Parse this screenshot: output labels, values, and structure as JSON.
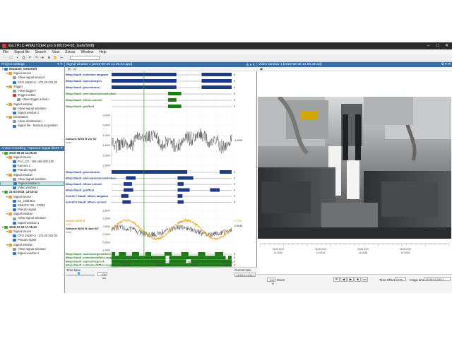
{
  "window": {
    "title": "iba.t  PLC-ANALYZER.pro 6 [00234-03_GebrShift]",
    "controls": [
      "–",
      "□",
      "✕"
    ]
  },
  "menu": [
    "File",
    "Signal file",
    "Search",
    "View",
    "Extras",
    "Window",
    "Help"
  ],
  "toolbar": {
    "icons": [
      "new-icon",
      "open-icon",
      "save-icon",
      "print-icon",
      "undo-icon",
      "redo-icon",
      "cursor-icon",
      "zoom-icon",
      "hand-icon",
      "measure-icon"
    ],
    "glyphs": [
      "▫",
      "▭",
      "▪",
      "⎙",
      "↶",
      "↷",
      "➤",
      "⊕",
      "✋",
      "⊢"
    ],
    "combo_value": ""
  },
  "project": {
    "header": "Project settings",
    "rows": [
      {
        "d": 0,
        "t": "00234-03_GebrShift",
        "b": true,
        "c": "#37c"
      },
      {
        "d": 1,
        "t": "Signal source",
        "c": "#e93"
      },
      {
        "d": 2,
        "t": "<New signal source>",
        "c": "#999"
      },
      {
        "d": 2,
        "t": "CPU 1516F-3 - 172.20.202.32",
        "c": "#37c"
      },
      {
        "d": 1,
        "t": "Trigger",
        "c": "#e93"
      },
      {
        "d": 2,
        "t": "<New trigger>",
        "c": "#999"
      },
      {
        "d": 2,
        "t": "Trigger action",
        "c": "#c33"
      },
      {
        "d": 3,
        "t": "<New trigger action>",
        "c": "#999"
      },
      {
        "d": 1,
        "t": "Signal window",
        "c": "#e93"
      },
      {
        "d": 2,
        "t": "<New signal window>",
        "c": "#999"
      },
      {
        "d": 2,
        "t": "Signal window 1",
        "c": "#37c"
      },
      {
        "d": 1,
        "t": "Destination",
        "c": "#e93"
      },
      {
        "d": 2,
        "t": "<New destination>",
        "c": "#999"
      },
      {
        "d": 2,
        "t": "Signal file - Manual acquisition",
        "c": "#37c"
      }
    ]
  },
  "recordings": {
    "header": "Active recording / Opened signal files",
    "rows": [
      {
        "d": 0,
        "t": "2019-08-26 14.05.33",
        "b": true,
        "c": "#3a3"
      },
      {
        "d": 1,
        "t": "Signal source",
        "c": "#e93"
      },
      {
        "d": 2,
        "t": "PLC_C3 - 192.168.200.125",
        "c": "#37c"
      },
      {
        "d": 2,
        "t": "Kamera 1",
        "c": "#37c"
      },
      {
        "d": 2,
        "t": "Pseudo signal",
        "c": "#37c"
      },
      {
        "d": 1,
        "t": "Signal window",
        "c": "#e93"
      },
      {
        "d": 2,
        "t": "<New signal window>",
        "c": "#999"
      },
      {
        "d": 2,
        "t": "Signal window 1",
        "c": "#37c",
        "sel": true
      },
      {
        "d": 2,
        "t": "Video window 1",
        "c": "#37c"
      },
      {
        "d": 0,
        "t": "21-03-2018_13-10-22",
        "b": true,
        "c": "#3a3"
      },
      {
        "d": 1,
        "t": "Signal source",
        "c": "#e93"
      },
      {
        "d": 2,
        "t": "C1_USB Box",
        "c": "#37c"
      },
      {
        "d": 2,
        "t": "SIMATIC S5 - COM1",
        "c": "#37c"
      },
      {
        "d": 2,
        "t": "Pseudo signal",
        "c": "#37c"
      },
      {
        "d": 1,
        "t": "Signal window",
        "c": "#e93"
      },
      {
        "d": 2,
        "t": "<New signal window>",
        "c": "#999"
      },
      {
        "d": 2,
        "t": "Signal window 1",
        "c": "#37c"
      },
      {
        "d": 0,
        "t": "2018-01-19 17.05.34",
        "b": true,
        "c": "#3a3"
      },
      {
        "d": 1,
        "t": "Signal source",
        "c": "#e93"
      },
      {
        "d": 2,
        "t": "CPU 1516F-3 - 172.20.202.32",
        "c": "#37c"
      },
      {
        "d": 2,
        "t": "Pseudo signal",
        "c": "#37c"
      },
      {
        "d": 1,
        "t": "Signal window",
        "c": "#e93"
      },
      {
        "d": 2,
        "t": "<New signal window>",
        "c": "#999"
      },
      {
        "d": 2,
        "t": "Signal window 1",
        "c": "#37c"
      }
    ]
  },
  "signal_window": {
    "title": "Signal window 1 [2019-08-26 14.05.33.apw]",
    "digital_top": [
      {
        "label": "Bfwp Staufl. schließen langsam",
        "color": "#1d3a8a",
        "value": "0",
        "segs": [
          [
            0.0,
            0.54
          ],
          [
            0.75,
            1.0
          ]
        ]
      },
      {
        "label": "Bfwp Staufl. nachschiegen",
        "color": "#1d3a8a",
        "value": "0",
        "segs": [
          [
            0.0,
            0.54
          ],
          [
            0.75,
            1.0
          ]
        ]
      },
      {
        "label": "Bfwp Staufl. geschlossen",
        "color": "#1d3a8a",
        "value": "0",
        "segs": [
          [
            0.0,
            0.54
          ],
          [
            0.75,
            1.0
          ]
        ]
      },
      {
        "label": "Bfwp Staufl. oben absenken/anheben",
        "color": "#1e7a16",
        "value": "0",
        "segs": [
          [
            0.47,
            0.58
          ]
        ]
      },
      {
        "label": "Bfwp Staufl. öffnen schnell",
        "color": "#1e7a16",
        "value": "0",
        "segs": [
          [
            0.47,
            0.54
          ]
        ]
      },
      {
        "label": "Bfwp Staufl. geöffnet",
        "color": "#1e7a16",
        "value": "0",
        "segs": [
          [
            0.47,
            0.58
          ]
        ]
      }
    ],
    "analog1": {
      "label": "Sollwert WGS B vor N7",
      "unit": "mm/s",
      "value": "-1,2005",
      "yticks": [
        "0,0000",
        "-0,5000",
        "-1,0000",
        "-1,5000",
        "-2,0000",
        "-2,5000"
      ]
    },
    "digital_mid": [
      {
        "label": "Bfwp Staufl. geschlossen",
        "color": "#1d3a8a",
        "value": "0",
        "segs": [
          [
            0.0,
            0.63
          ],
          [
            0.9,
            1.0
          ]
        ]
      },
      {
        "label": "Bfwp Staufl. oben absenken/anheben",
        "color": "#1d3a8a",
        "value": "0",
        "segs": [
          [
            0.12,
            0.2
          ],
          [
            0.55,
            0.68
          ]
        ]
      },
      {
        "label": "Bfwp Staufl. öffnen schnell",
        "color": "#1d3a8a",
        "value": "0",
        "segs": [
          [
            0.1,
            0.17
          ],
          [
            0.55,
            0.6
          ]
        ]
      },
      {
        "label": "Bfwp Staufl. geöffnet",
        "color": "#1d3a8a",
        "value": "0",
        "segs": [
          [
            0.1,
            0.18
          ],
          [
            0.55,
            0.65
          ],
          [
            0.82,
            0.9
          ]
        ]
      },
      {
        "label": "Schritt 7 Staufl. öffnen langsam",
        "color": "#1d3a8a",
        "value": "0",
        "segs": [
          [
            0.08,
            0.14
          ],
          [
            0.55,
            0.59
          ]
        ]
      },
      {
        "label": "Schritt 8 Staufl. öffnen schnell",
        "color": "#1d3a8a",
        "value": "0",
        "segs": [
          [
            0.09,
            0.16
          ],
          [
            0.55,
            0.6
          ]
        ]
      }
    ],
    "analog2": {
      "label1": "Istwert WGS B",
      "unit1": "mm/s",
      "label2": "Sollwert WGS B nach N7",
      "unit2": "mm/s",
      "value1": "0,7500",
      "value2": "-0,5645",
      "yticks": [
        "1,5000",
        "1,0000",
        "0,5000",
        "0,0000",
        "-0,5000",
        "-1,0000"
      ]
    },
    "digital_bot": [
      {
        "label": "Bfwp Staufl. nachschiegen/öffnen",
        "color": "#1e7a16",
        "value": "0",
        "segs": [
          [
            0.0,
            0.03
          ],
          [
            0.06,
            0.12
          ],
          [
            0.17,
            0.23
          ],
          [
            0.28,
            0.33
          ],
          [
            0.44,
            0.5
          ],
          [
            0.58,
            0.64
          ],
          [
            0.72,
            0.78
          ],
          [
            0.86,
            0.93
          ]
        ]
      },
      {
        "label": "Bfwp Staufl. schließen/öffnen langsam",
        "color": "#1e7a16",
        "value": "0",
        "segs": [
          [
            0.0,
            0.45
          ],
          [
            0.48,
            0.95
          ],
          [
            0.97,
            1.0
          ]
        ]
      },
      {
        "label": "Bfwp Staufl. nachschiegen A",
        "color": "#1e7a16",
        "value": "0",
        "segs": [
          [
            0.0,
            0.45
          ],
          [
            0.48,
            0.62
          ],
          [
            0.66,
            1.0
          ]
        ]
      },
      {
        "label": "Bfwp Staufl. schließen/öffnen langsam",
        "color": "#1e7a16",
        "value": "0",
        "segs": [
          [
            0.0,
            1.0
          ]
        ]
      }
    ],
    "time_axis": [
      "26.08.2019\n14:05:40",
      "26.08.2019\n14:05:44",
      "26.08.2019\n14:05:48",
      "26.08.2019\n14:05:52"
    ],
    "footer": {
      "time_base": "Time base",
      "zoom": "100 ms",
      "current_time_label": "Current time",
      "current_time": "14:05:41.043.1"
    }
  },
  "video_window": {
    "title": "Video window 1 [2019-08-26 14.05.33.avi]",
    "time_axis": [
      "26.08.2019\n14:05:40",
      "26.08.2019\n14:05:44",
      "26.08.2019\n14:05:48",
      "26.08.2019\n14:05:52"
    ],
    "footer": {
      "zoom": "100 %",
      "zoom_label": "Zoom",
      "play_buttons": [
        "⏮",
        "◀",
        "▶",
        "■",
        "⏭"
      ],
      "time_offset_label": "Time Offset:",
      "time_offset": "0 ms",
      "image_time_label": "Image time",
      "image_time": "14:05:41.043.1"
    }
  }
}
